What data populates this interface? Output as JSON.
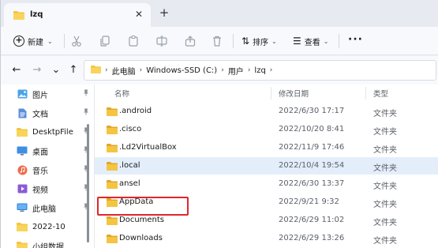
{
  "window": {
    "tab_title": "lzq",
    "tab_close": "✕",
    "new_tab": "+"
  },
  "toolbar": {
    "new_label": "新建",
    "sort_label": "排序",
    "view_label": "查看",
    "more_label": "···",
    "icons": [
      "cut-icon",
      "copy-icon",
      "paste-icon",
      "rename-icon",
      "share-icon",
      "delete-icon"
    ]
  },
  "nav": {
    "back": "←",
    "forward": "→",
    "history": "⌄",
    "up": "↑"
  },
  "breadcrumb": [
    "此电脑",
    "Windows-SSD (C:)",
    "用户",
    "lzq"
  ],
  "sidebar": {
    "items": [
      {
        "label": "图片",
        "icon": "pictures-icon",
        "pinned": true
      },
      {
        "label": "文档",
        "icon": "documents-icon",
        "pinned": true
      },
      {
        "label": "DesktpFile",
        "icon": "folder-icon",
        "pinned": true
      },
      {
        "label": "桌面",
        "icon": "desktop-icon",
        "pinned": true
      },
      {
        "label": "音乐",
        "icon": "music-icon",
        "pinned": true
      },
      {
        "label": "视频",
        "icon": "videos-icon",
        "pinned": true
      },
      {
        "label": "此电脑",
        "icon": "computer-icon",
        "pinned": true
      },
      {
        "label": "2022-10",
        "icon": "folder-icon",
        "pinned": false
      },
      {
        "label": "小组数据",
        "icon": "folder-icon",
        "pinned": false
      }
    ],
    "pin_glyph": "📌"
  },
  "columns": {
    "name": "名称",
    "date": "修改日期",
    "type": "类型"
  },
  "files": [
    {
      "name": ".android",
      "date": "2022/6/30 17:17",
      "type": "文件夹"
    },
    {
      "name": ".cisco",
      "date": "2022/10/20 8:41",
      "type": "文件夹"
    },
    {
      "name": ".Ld2VirtualBox",
      "date": "2022/11/9 17:46",
      "type": "文件夹"
    },
    {
      "name": ".local",
      "date": "2022/10/4 19:54",
      "type": "文件夹"
    },
    {
      "name": "ansel",
      "date": "2022/6/30 13:37",
      "type": "文件夹"
    },
    {
      "name": "AppData",
      "date": "2022/9/21 9:32",
      "type": "文件夹"
    },
    {
      "name": "Documents",
      "date": "2022/6/29 11:02",
      "type": "文件夹"
    },
    {
      "name": "Downloads",
      "date": "2022/6/29 13:26",
      "type": "文件夹"
    }
  ],
  "selected_row_index": 3,
  "highlighted_row_index": 5,
  "colors": {
    "folder": "#f4c542",
    "folder_dark": "#e0a82a",
    "selection": "#e4eefb",
    "highlight_border": "#e0262a"
  }
}
